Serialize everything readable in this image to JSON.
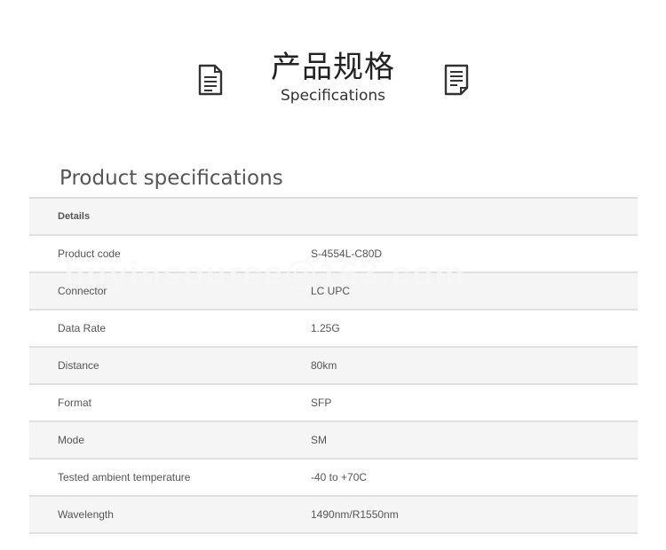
{
  "header": {
    "title_cn": "产品规格",
    "title_en": "Specifications",
    "left_icon": "document-icon",
    "right_icon": "document-icon"
  },
  "section": {
    "title": "Product specifications"
  },
  "table": {
    "header_label": "Details",
    "rows": [
      {
        "label": "Product code",
        "value": "S-4554L-C80D"
      },
      {
        "label": "Connector",
        "value": "LC UPC"
      },
      {
        "label": "Data Rate",
        "value": "1.25G"
      },
      {
        "label": "Distance",
        "value": "80km"
      },
      {
        "label": "Format",
        "value": "SFP"
      },
      {
        "label": "Mode",
        "value": "SM"
      },
      {
        "label": "Tested ambient temperature",
        "value": "-40 to +70C"
      },
      {
        "label": "Wavelength",
        "value": "1490nm/R1550nm"
      }
    ]
  },
  "watermark": {
    "text": "buyinsource@163.com"
  },
  "colors": {
    "row_shade": "#f5f5f5",
    "border": "#e0e0e0",
    "text": "#555555",
    "title": "#222222"
  }
}
